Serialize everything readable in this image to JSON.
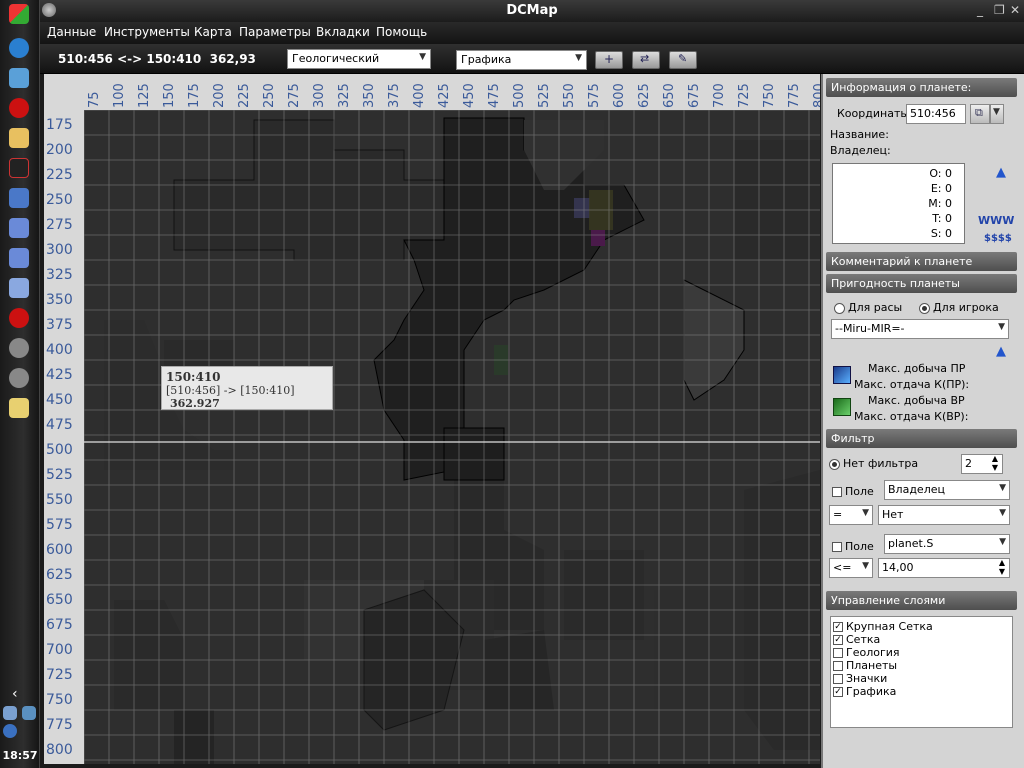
{
  "taskbar": {
    "clock": "18:57"
  },
  "window": {
    "title": "DCMap",
    "minimize": "_",
    "restore": "❐",
    "close": "✕"
  },
  "menu": [
    "Данные",
    "Инструменты",
    "Карта",
    "Параметры",
    "Вкладки",
    "Помощь"
  ],
  "toolbar": {
    "coords_readout": "510:456 <-> 150:410  362,93",
    "layer_combo": "Геологический",
    "mode_combo": "Графика"
  },
  "map": {
    "x_ticks": [
      "75",
      "100",
      "125",
      "150",
      "175",
      "200",
      "225",
      "250",
      "275",
      "300",
      "325",
      "350",
      "375",
      "400",
      "425",
      "450",
      "475",
      "500",
      "525",
      "550",
      "575",
      "600",
      "625",
      "650",
      "675",
      "700",
      "725",
      "750",
      "775",
      "800"
    ],
    "y_ticks": [
      "175",
      "200",
      "225",
      "250",
      "275",
      "300",
      "325",
      "350",
      "375",
      "400",
      "425",
      "450",
      "475",
      "500",
      "525",
      "550",
      "575",
      "600",
      "625",
      "650",
      "675",
      "700",
      "725",
      "750",
      "775",
      "800"
    ],
    "tooltip": {
      "title": "150:410",
      "route": "[510:456] -> [150:410]",
      "distance": "362.927"
    }
  },
  "panel": {
    "info_header": "Информация о планете:",
    "coords_label": "Координаты",
    "coords_value": "510:456",
    "name_label": "Название:",
    "owner_label": "Владелец:",
    "stats": [
      "O: 0",
      "E: 0",
      "M: 0",
      "T: 0",
      "S: 0"
    ],
    "www": "WWW",
    "money": "$$$$",
    "comment_header": "Комментарий к планете",
    "suit_header": "Пригодность планеты",
    "radio_race": "Для расы",
    "radio_player": "Для игрока",
    "player_combo": "--Miru-MIR=-",
    "max_pr": "Макс. добыча ПР",
    "max_out_pr": "Макс. отдача К(ПР):",
    "max_vr": "Макс. добыча ВР",
    "max_out_vr": "Макс. отдача К(ВР):",
    "filter_header": "Фильтр",
    "no_filter": "Нет фильтра",
    "filter_count": "2",
    "field_label": "Поле",
    "field1_value": "Владелец",
    "op1": "=",
    "value1": "Нет",
    "field2_label": "Поле",
    "field2_value": "planet.S",
    "op2": "<=",
    "value2": "14,00",
    "layers_header": "Управление слоями",
    "layers": [
      {
        "label": "Крупная Сетка",
        "checked": true
      },
      {
        "label": "Сетка",
        "checked": true
      },
      {
        "label": "Геология",
        "checked": false
      },
      {
        "label": "Планеты",
        "checked": false
      },
      {
        "label": "Значки",
        "checked": false
      },
      {
        "label": "Графика",
        "checked": true
      }
    ]
  }
}
